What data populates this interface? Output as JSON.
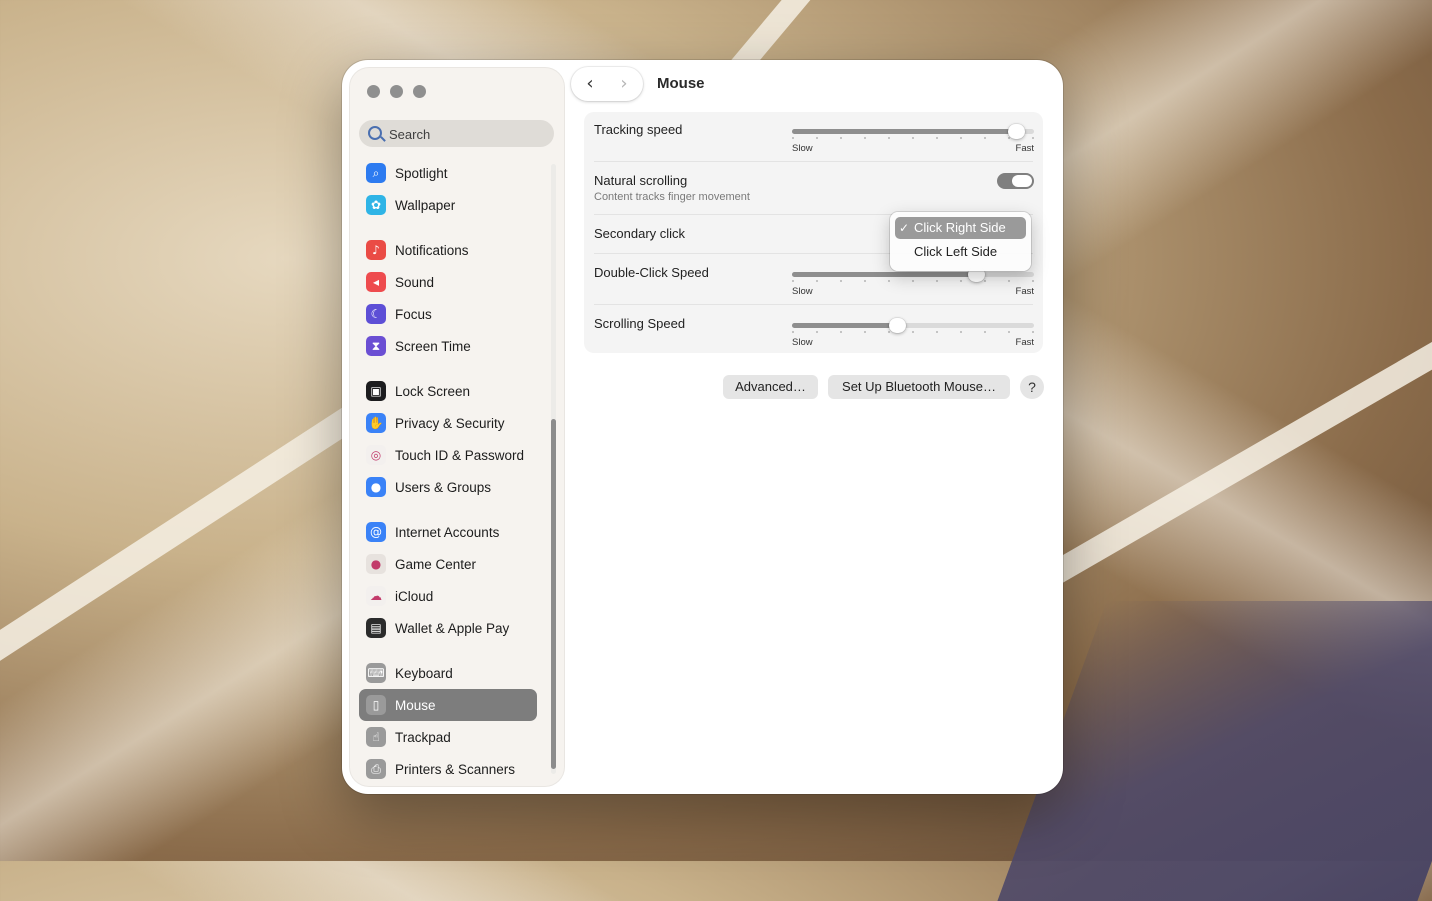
{
  "window_title": "Mouse",
  "search": {
    "placeholder": "Search"
  },
  "sidebar": {
    "items": [
      {
        "label": "Spotlight",
        "icon": "spotlight-icon",
        "color": "#2d7bf0",
        "glyph": "⌕"
      },
      {
        "label": "Wallpaper",
        "icon": "wallpaper-icon",
        "color": "#2fb4e6",
        "glyph": "✿"
      },
      {
        "label": "Notifications",
        "icon": "notifications-icon",
        "color": "#ea4b45",
        "glyph": "♪"
      },
      {
        "label": "Sound",
        "icon": "sound-icon",
        "color": "#ee4b4e",
        "glyph": "◂"
      },
      {
        "label": "Focus",
        "icon": "focus-icon",
        "color": "#5d4fd6",
        "glyph": "☾"
      },
      {
        "label": "Screen Time",
        "icon": "screen-time-icon",
        "color": "#6b4fd3",
        "glyph": "⧗"
      },
      {
        "label": "Lock Screen",
        "icon": "lock-screen-icon",
        "color": "#1c1c1e",
        "glyph": "▣"
      },
      {
        "label": "Privacy & Security",
        "icon": "privacy-hand-icon",
        "color": "#3a82f7",
        "glyph": "✋"
      },
      {
        "label": "Touch ID & Password",
        "icon": "fingerprint-icon",
        "color": "#f3f0ee",
        "glyph": "◎"
      },
      {
        "label": "Users & Groups",
        "icon": "users-groups-icon",
        "color": "#3a82f7",
        "glyph": "●"
      },
      {
        "label": "Internet Accounts",
        "icon": "internet-accounts-icon",
        "color": "#3a82f7",
        "glyph": "@"
      },
      {
        "label": "Game Center",
        "icon": "game-center-icon",
        "color": "#e7e2de",
        "glyph": "●"
      },
      {
        "label": "iCloud",
        "icon": "icloud-icon",
        "color": "#f3f0ee",
        "glyph": "☁"
      },
      {
        "label": "Wallet & Apple Pay",
        "icon": "wallet-icon",
        "color": "#2b2b2b",
        "glyph": "▤"
      },
      {
        "label": "Keyboard",
        "icon": "keyboard-icon",
        "color": "#9a9a9a",
        "glyph": "⌨"
      },
      {
        "label": "Mouse",
        "icon": "mouse-icon",
        "color": "#9a9a9a",
        "glyph": "▯"
      },
      {
        "label": "Trackpad",
        "icon": "trackpad-icon",
        "color": "#9a9a9a",
        "glyph": "☝"
      },
      {
        "label": "Printers & Scanners",
        "icon": "printer-icon",
        "color": "#9a9a9a",
        "glyph": "⎙"
      }
    ],
    "selected": "Mouse"
  },
  "settings": {
    "tracking_speed": {
      "label": "Tracking speed",
      "slow": "Slow",
      "fast": "Fast",
      "value": 0.96
    },
    "natural_scrolling": {
      "label": "Natural scrolling",
      "sublabel": "Content tracks finger movement",
      "on": true
    },
    "secondary_click": {
      "label": "Secondary click",
      "options": [
        "Click Right Side",
        "Click Left Side"
      ],
      "selected": "Click Right Side",
      "check": "✓"
    },
    "double_click_speed": {
      "label": "Double-Click Speed",
      "slow": "Slow",
      "fast": "Fast",
      "value": 0.78
    },
    "scrolling_speed": {
      "label": "Scrolling Speed",
      "slow": "Slow",
      "fast": "Fast",
      "value": 0.43
    }
  },
  "buttons": {
    "advanced": "Advanced…",
    "bluetooth": "Set Up Bluetooth Mouse…",
    "help": "?"
  }
}
